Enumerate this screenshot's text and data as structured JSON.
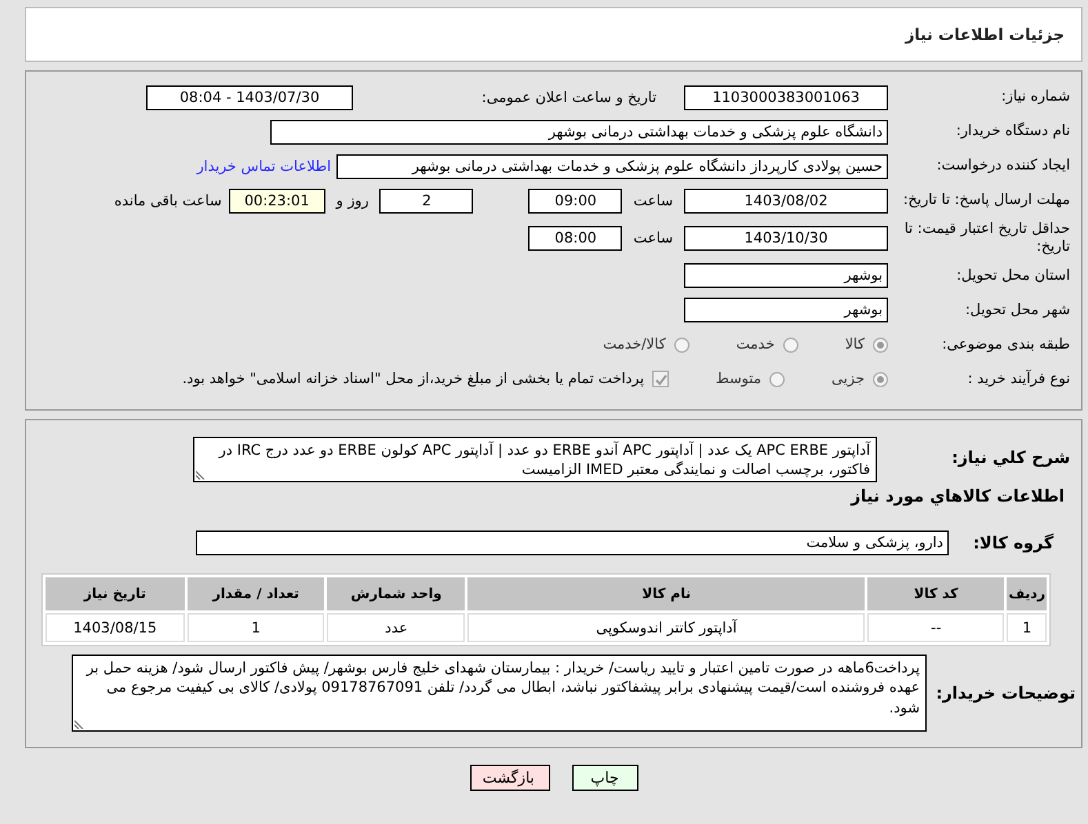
{
  "header": {
    "title": "جزئیات اطلاعات نیاز"
  },
  "need_number": {
    "label": "شماره نیاز:",
    "value": "1103000383001063"
  },
  "announce": {
    "label": "تاریخ و ساعت اعلان عمومی:",
    "value": "1403/07/30 - 08:04"
  },
  "buyer_org": {
    "label": "نام دستگاه خریدار:",
    "value": "دانشگاه علوم پزشکی و خدمات بهداشتی درمانی بوشهر"
  },
  "requester": {
    "label": "ایجاد کننده درخواست:",
    "value": "حسین پولادی کارپرداز دانشگاه علوم پزشکی و خدمات بهداشتی درمانی بوشهر",
    "link": "اطلاعات تماس خریدار"
  },
  "reply_deadline": {
    "label": "مهلت ارسال پاسخ: تا تاریخ:",
    "date": "1403/08/02",
    "time_label": "ساعت",
    "time": "09:00",
    "days": "2",
    "days_label": "روز و",
    "remaining": "00:23:01",
    "remaining_label": "ساعت باقی مانده"
  },
  "price_validity": {
    "label": "حداقل تاریخ اعتبار قیمت: تا تاریخ:",
    "date": "1403/10/30",
    "time_label": "ساعت",
    "time": "08:00"
  },
  "province": {
    "label": "استان محل تحویل:",
    "value": "بوشهر"
  },
  "city": {
    "label": "شهر محل تحویل:",
    "value": "بوشهر"
  },
  "category": {
    "label": "طبقه بندی موضوعی:",
    "disabled": true,
    "options": [
      {
        "label": "کالا",
        "selected": true
      },
      {
        "label": "خدمت",
        "selected": false
      },
      {
        "label": "کالا/خدمت",
        "selected": false
      }
    ]
  },
  "process": {
    "label": "نوع فرآیند خرید :",
    "disabled": true,
    "options": [
      {
        "label": "جزیی",
        "selected": true
      },
      {
        "label": "متوسط",
        "selected": false
      }
    ],
    "treasury": {
      "checked": true,
      "text": "پرداخت تمام یا بخشی از مبلغ خرید،از محل \"اسناد خزانه اسلامی\" خواهد بود."
    }
  },
  "description": {
    "label": "شرح کلي نياز:",
    "text": "آداپتور APC ERBE یک عدد | آداپتور APC آندو ERBE دو عدد | آداپتور APC کولون ERBE دو عدد درج IRC در فاکتور، برچسب اصالت و نمایندگی معتبر IMED الزامیست"
  },
  "goods_info_title": "اطلاعات كالاهاي مورد نياز",
  "goods_group": {
    "label": "گروه کالا:",
    "value": "دارو، پزشکی و سلامت"
  },
  "table": {
    "columns": [
      "ردیف",
      "کد کالا",
      "نام کالا",
      "واحد شمارش",
      "تعداد / مقدار",
      "تاریخ نیاز"
    ],
    "rows": [
      [
        "1",
        "--",
        "آداپتور کاتتر اندوسکوپی",
        "عدد",
        "1",
        "1403/08/15"
      ]
    ]
  },
  "buyer_notes": {
    "label": "توضیحات خریدار:",
    "text": "پرداخت6ماهه در صورت تامین اعتبار و تایید ریاست/ خریدار : بیمارستان شهدای خلیج فارس بوشهر/ پیش فاکتور ارسال شود/ هزینه حمل بر عهده فروشنده است/قیمت پیشنهادی برابر پیشفاکتور نباشد، ابطال می گردد/ تلفن 09178767091 پولادی/ کالای بی کیفیت مرجوع می شود."
  },
  "buttons": [
    {
      "kind": "print",
      "label": "چاپ"
    },
    {
      "kind": "back",
      "label": "بازگشت"
    }
  ]
}
